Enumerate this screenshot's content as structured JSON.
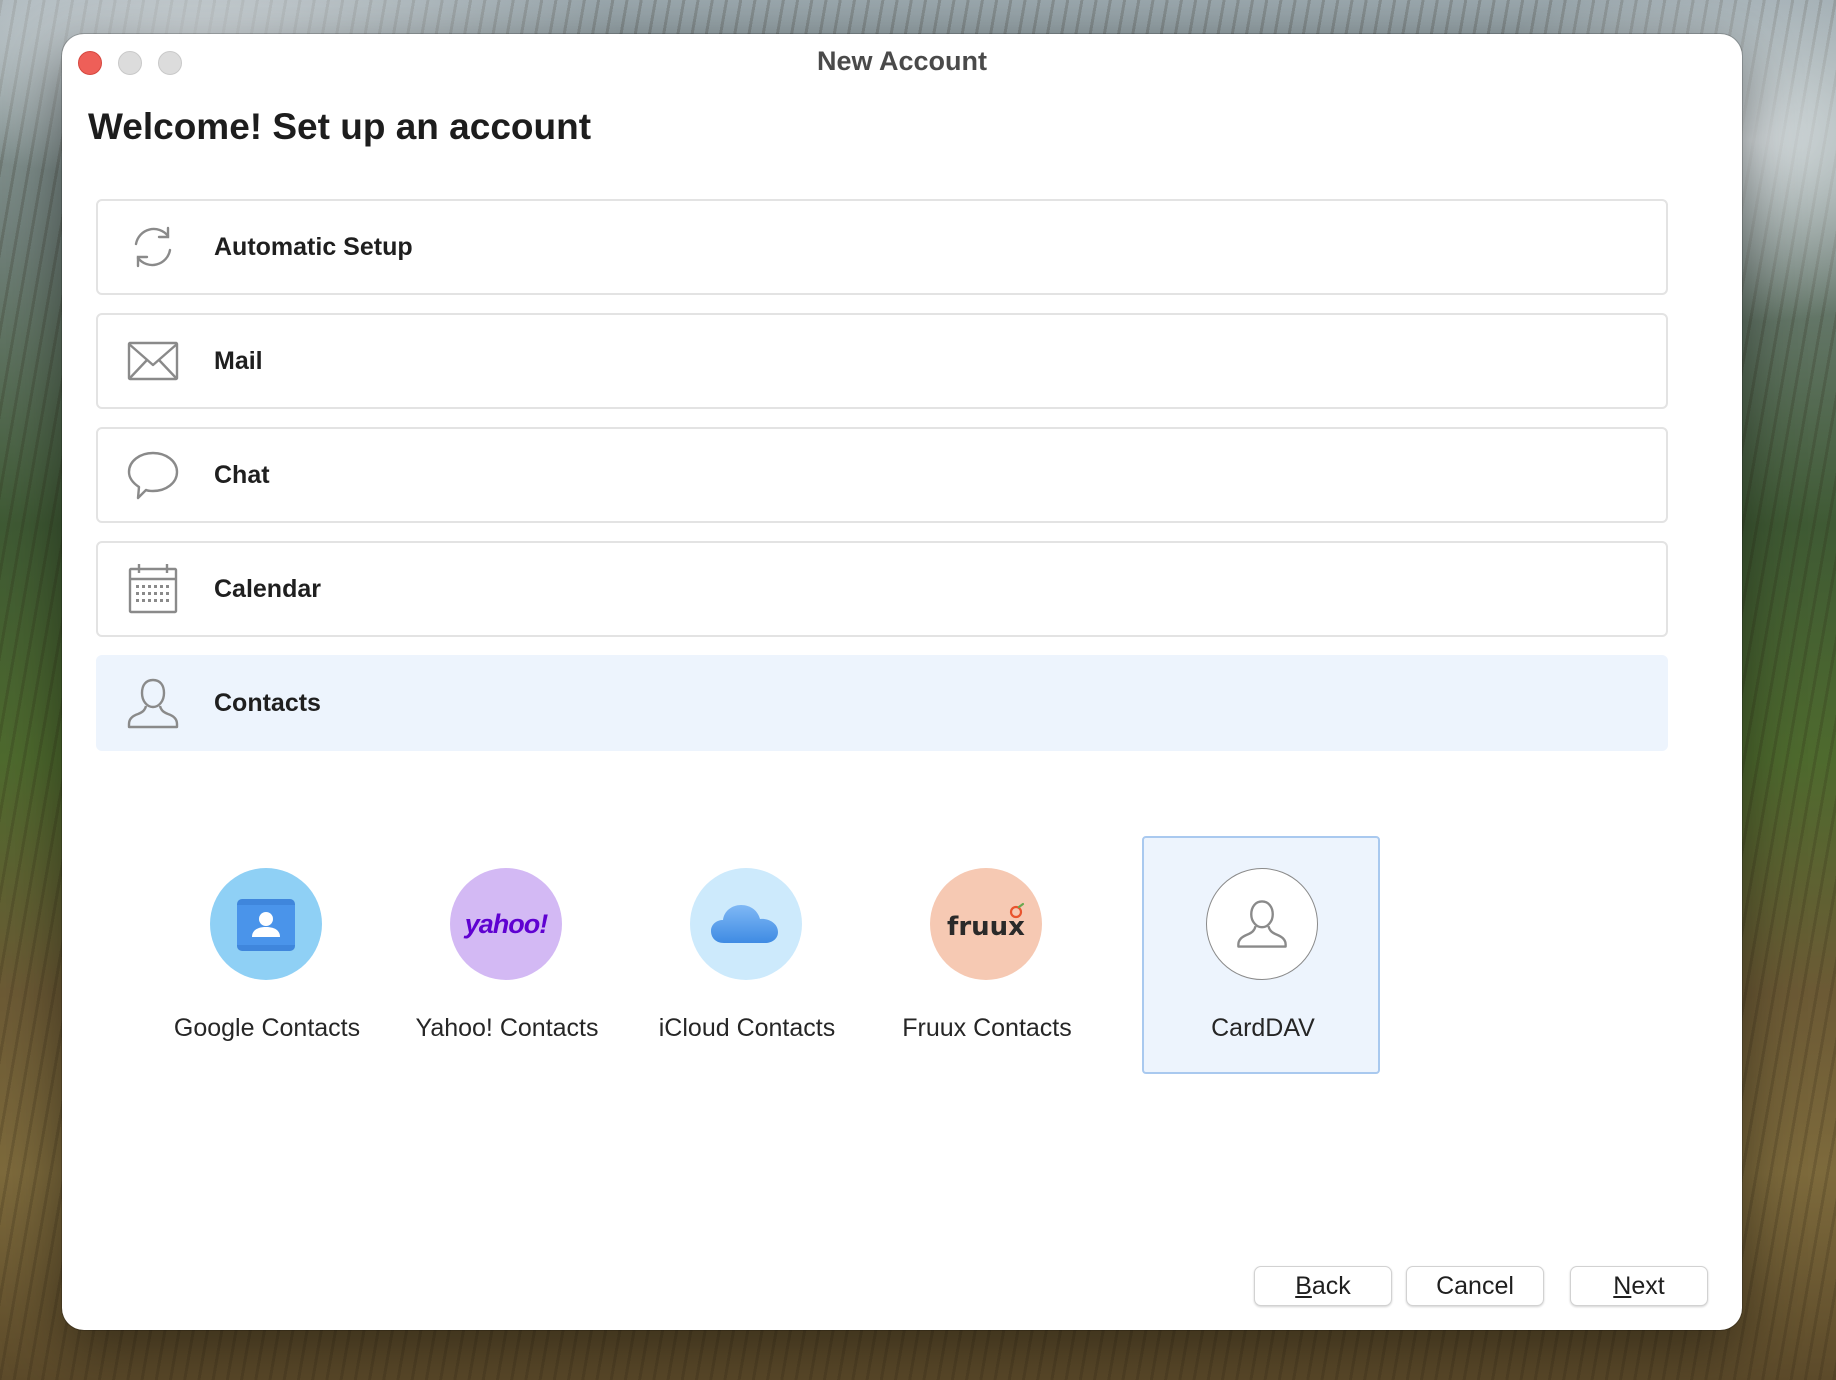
{
  "window": {
    "title": "New Account"
  },
  "page": {
    "heading": "Welcome! Set up an account"
  },
  "categories": [
    {
      "label": "Automatic Setup",
      "icon": "sync-icon",
      "selected": false
    },
    {
      "label": "Mail",
      "icon": "envelope-icon",
      "selected": false
    },
    {
      "label": "Chat",
      "icon": "speech-bubble-icon",
      "selected": false
    },
    {
      "label": "Calendar",
      "icon": "calendar-icon",
      "selected": false
    },
    {
      "label": "Contacts",
      "icon": "person-icon",
      "selected": true
    }
  ],
  "providers": [
    {
      "label": "Google Contacts",
      "icon": "google-contacts-icon",
      "color": "#8fd0f5",
      "selected": false
    },
    {
      "label": "Yahoo! Contacts",
      "icon": "yahoo-logo-icon",
      "logo_text": "yahoo!",
      "color": "#d3b9f4",
      "selected": false
    },
    {
      "label": "iCloud Contacts",
      "icon": "icloud-icon",
      "color": "#cdeafc",
      "selected": false
    },
    {
      "label": "Fruux Contacts",
      "icon": "fruux-logo-icon",
      "logo_text": "fruux",
      "color": "#f6c9b3",
      "selected": false
    },
    {
      "label": "CardDAV",
      "icon": "carddav-person-icon",
      "color": "#ffffff",
      "selected": true
    }
  ],
  "buttons": {
    "back": {
      "mnemonic": "B",
      "rest": "ack"
    },
    "cancel": {
      "label": "Cancel"
    },
    "next": {
      "mnemonic": "N",
      "rest": "ext"
    }
  },
  "colors": {
    "selected_bg": "#edf4fd",
    "selected_border": "#a9c9ef",
    "close": "#ee5f58",
    "icon_stroke": "#8a8a8a"
  }
}
